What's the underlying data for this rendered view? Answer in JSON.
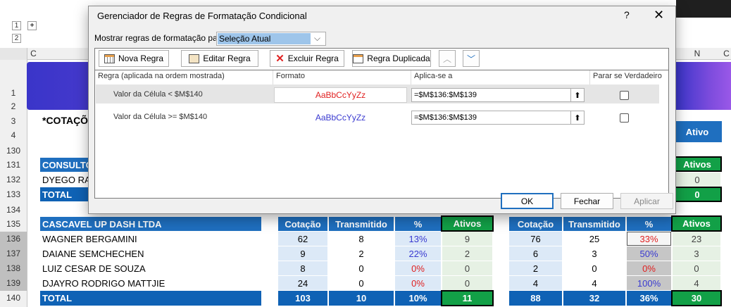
{
  "excel": {
    "group_levels": [
      "1",
      "2"
    ],
    "group_plus": "+",
    "col_headers": {
      "c": "C",
      "n": "N",
      "o": "C"
    },
    "rows": [
      "1",
      "2",
      "3",
      "4",
      "130",
      "131",
      "132",
      "133",
      "134",
      "135",
      "136",
      "137",
      "138",
      "139",
      "140"
    ],
    "title_cell": "*COTAÇÕ",
    "ativo_header": "Ativo",
    "company1": {
      "name": "CONSULTO",
      "person": "DYEGO RAF",
      "total": "TOTAL",
      "right_ativos_header": "Ativos",
      "right_ativos_value": "0",
      "right_total": "0"
    },
    "company2": {
      "name": "CASCAVEL UP DASH LTDA",
      "headers": {
        "cotacao": "Cotação",
        "transmitido": "Transmitido",
        "pct": "%",
        "ativos": "Ativos"
      },
      "rows": [
        {
          "name": "WAGNER BERGAMINI",
          "cot": "62",
          "trans": "8",
          "pct": "13%",
          "ativos": "9",
          "cot2": "76",
          "trans2": "25",
          "pct2": "33%",
          "ativos2": "23"
        },
        {
          "name": "DAIANE SEMCHECHEN",
          "cot": "9",
          "trans": "2",
          "pct": "22%",
          "ativos": "2",
          "cot2": "6",
          "trans2": "3",
          "pct2": "50%",
          "ativos2": "3"
        },
        {
          "name": "LUIZ CESAR DE SOUZA",
          "cot": "8",
          "trans": "0",
          "pct": "0%",
          "ativos": "0",
          "cot2": "2",
          "trans2": "0",
          "pct2": "0%",
          "ativos2": "0"
        },
        {
          "name": "DJAYRO RODRIGO MATTJIE",
          "cot": "24",
          "trans": "0",
          "pct": "0%",
          "ativos": "0",
          "cot2": "4",
          "trans2": "4",
          "pct2": "100%",
          "ativos2": "4"
        }
      ],
      "total": {
        "label": "TOTAL",
        "cot": "103",
        "trans": "10",
        "pct": "10%",
        "ativos": "11",
        "cot2": "88",
        "trans2": "32",
        "pct2": "36%",
        "ativos2": "30"
      }
    }
  },
  "dialog": {
    "title": "Gerenciador de Regras de Formatação Condicional",
    "help": "?",
    "close": "✕",
    "show_rules_label": "Mostrar regras de formatação para:",
    "show_rules_value": "Seleção Atual",
    "toolbar": {
      "new": "Nova Regra",
      "edit": "Editar Regra",
      "delete": "Excluir Regra",
      "duplicate": "Regra Duplicada"
    },
    "columns": {
      "rule": "Regra (aplicada na ordem mostrada)",
      "format": "Formato",
      "applies": "Aplica-se a",
      "stop": "Parar se Verdadeiro"
    },
    "rules": [
      {
        "rule": "Valor da Célula < $M$140",
        "format": "AaBbCcYyZz",
        "applies": "=$M$136:$M$139"
      },
      {
        "rule": "Valor da Célula >= $M$140",
        "format": "AaBbCcYyZz",
        "applies": "=$M$136:$M$139"
      }
    ],
    "buttons": {
      "ok": "OK",
      "close": "Fechar",
      "apply": "Aplicar"
    }
  },
  "colors": {
    "header_blue": "#1f6fbf",
    "header_green": "#12a047",
    "red_text": "#e02020",
    "blue_text": "#3a3ad0"
  }
}
